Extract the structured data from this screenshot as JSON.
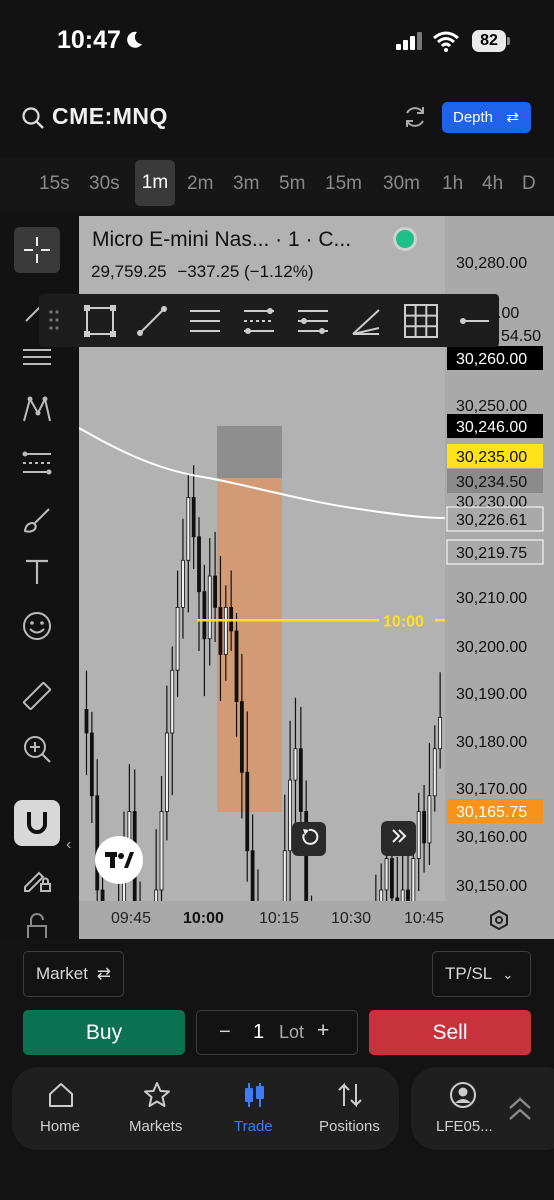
{
  "status_bar": {
    "time": "10:47",
    "battery": "82"
  },
  "header": {
    "symbol": "CME:MNQ",
    "depth_label": "Depth"
  },
  "timeframes": [
    {
      "label": "15s",
      "active": false
    },
    {
      "label": "30s",
      "active": false
    },
    {
      "label": "1m",
      "active": true
    },
    {
      "label": "2m",
      "active": false
    },
    {
      "label": "3m",
      "active": false
    },
    {
      "label": "5m",
      "active": false
    },
    {
      "label": "15m",
      "active": false
    },
    {
      "label": "30m",
      "active": false
    },
    {
      "label": "1h",
      "active": false
    },
    {
      "label": "4h",
      "active": false
    },
    {
      "label": "D",
      "active": false
    }
  ],
  "left_toolbar": [
    "crosshair-icon",
    "trend-line-icon",
    "horizontal-lines-icon",
    "pattern-icon",
    "fib-icon",
    "brush-icon",
    "text-icon",
    "emoji-icon",
    "ruler-icon",
    "zoom-in-icon",
    "magnet-icon",
    "lock-draw-icon",
    "unlock-icon"
  ],
  "drawing_toolbar": [
    "rectangle-tool-icon",
    "line-tool-icon",
    "parallel-channel-icon",
    "fib-retracement-icon",
    "fib-extension-icon",
    "trend-angle-icon",
    "grid-icon",
    "ray-icon"
  ],
  "legend": {
    "title": "Micro E-mini Nas...  · 1 · C...",
    "price": "29,759.25",
    "change": "−337.25 (−1.12%)"
  },
  "chart_data": {
    "type": "candlestick",
    "x_ticks": [
      "09:45",
      "10:00",
      "10:15",
      "10:30",
      "10:45"
    ],
    "y_ticks": [
      "30,280.00",
      "30,250.00",
      "30,230.00",
      "30,210.00",
      "30,200.00",
      "30,190.00",
      "30,180.00",
      "30,170.00",
      "30,160.00",
      "30,150.00"
    ],
    "ylim": [
      30145,
      30285
    ],
    "price_tags": [
      {
        "value": "30,260.00",
        "style": "dark"
      },
      {
        "value": "30,246.00",
        "style": "dark"
      },
      {
        "value": "30,235.00",
        "style": "yellow"
      },
      {
        "value": "30,234.50",
        "style": "gray"
      },
      {
        "value": "30,226.61",
        "style": "outline"
      },
      {
        "value": "30,219.75",
        "style": "outline"
      },
      {
        "value": "30,165.75",
        "style": "orange"
      }
    ],
    "partial_tick": "54.50",
    "partial_tick_top": ".00",
    "horizontal_line": {
      "value": 30235,
      "label": "10:00",
      "color": "#ffe21a"
    },
    "closes": [
      30220,
      30212,
      30200,
      30190,
      30178,
      30182,
      30195,
      30205,
      30210,
      30198,
      30188,
      30180,
      30190,
      30200,
      30210,
      30220,
      30228,
      30236,
      30242,
      30250,
      30245,
      30238,
      30232,
      30240,
      30236,
      30230,
      30236,
      30233,
      30224,
      30215,
      30205,
      30198,
      30190,
      30186,
      30182,
      30180,
      30192,
      30205,
      30214,
      30218,
      30210,
      30196,
      30184,
      30180,
      30176,
      30174,
      30176,
      30178,
      30180,
      30178,
      30175,
      30176,
      30180,
      30190,
      30196,
      30200,
      30204,
      30199,
      30196,
      30200,
      30196,
      30204,
      30210,
      30206,
      30212,
      30218,
      30222
    ]
  },
  "chart_buttons": {
    "reset": "reset-icon",
    "scroll": "chevrons-right-icon"
  },
  "order_panel": {
    "order_type": "Market",
    "tpsl": "TP/SL",
    "buy_label": "Buy",
    "sell_label": "Sell",
    "minus": "−",
    "quantity": "1",
    "unit": "Lot",
    "plus": "+"
  },
  "nav": {
    "items": [
      {
        "label": "Home",
        "icon": "home-icon",
        "active": false
      },
      {
        "label": "Markets",
        "icon": "star-icon",
        "active": false
      },
      {
        "label": "Trade",
        "icon": "candles-icon",
        "active": true
      },
      {
        "label": "Positions",
        "icon": "positions-icon",
        "active": false
      }
    ],
    "account": "LFE05..."
  },
  "colors": {
    "accent": "#1e63e9",
    "buy": "#0b7150",
    "sell": "#c8323d",
    "line": "#ffe21a",
    "tag_orange": "#f7931a"
  }
}
